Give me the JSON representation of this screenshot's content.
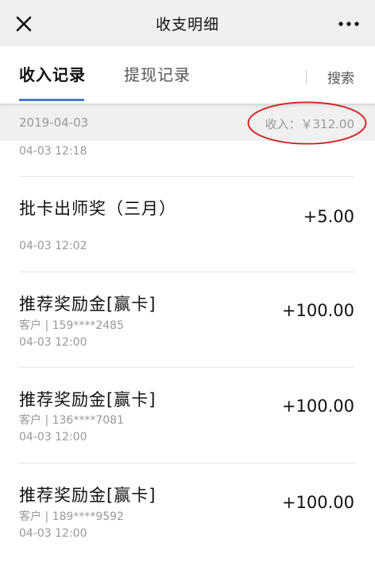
{
  "header": {
    "title": "收支明细",
    "close_icon": "close-icon",
    "more_icon": "more-icon"
  },
  "tabs": {
    "active": "收入记录",
    "inactive": "提现记录",
    "search": "搜索",
    "accent": "#4a7bd0"
  },
  "summary": {
    "date": "2019-04-03",
    "income": "收入：￥312.00",
    "highlight_color": "#d22b2b"
  },
  "records": [
    {
      "time": "04-03 12:18"
    },
    {
      "name": "批卡出师奖（三月）",
      "amount": "+5.00",
      "time": "04-03 12:02"
    },
    {
      "name": "推荐奖励金[赢卡]",
      "amount": "+100.00",
      "sub": "客户 | 159****2485",
      "time": "04-03 12:00"
    },
    {
      "name": "推荐奖励金[赢卡]",
      "amount": "+100.00",
      "sub": "客户 | 136****7081",
      "time": "04-03 12:00"
    },
    {
      "name": "推荐奖励金[赢卡]",
      "amount": "+100.00",
      "sub": "客户 | 189****9592",
      "time": "04-03 12:00"
    }
  ]
}
